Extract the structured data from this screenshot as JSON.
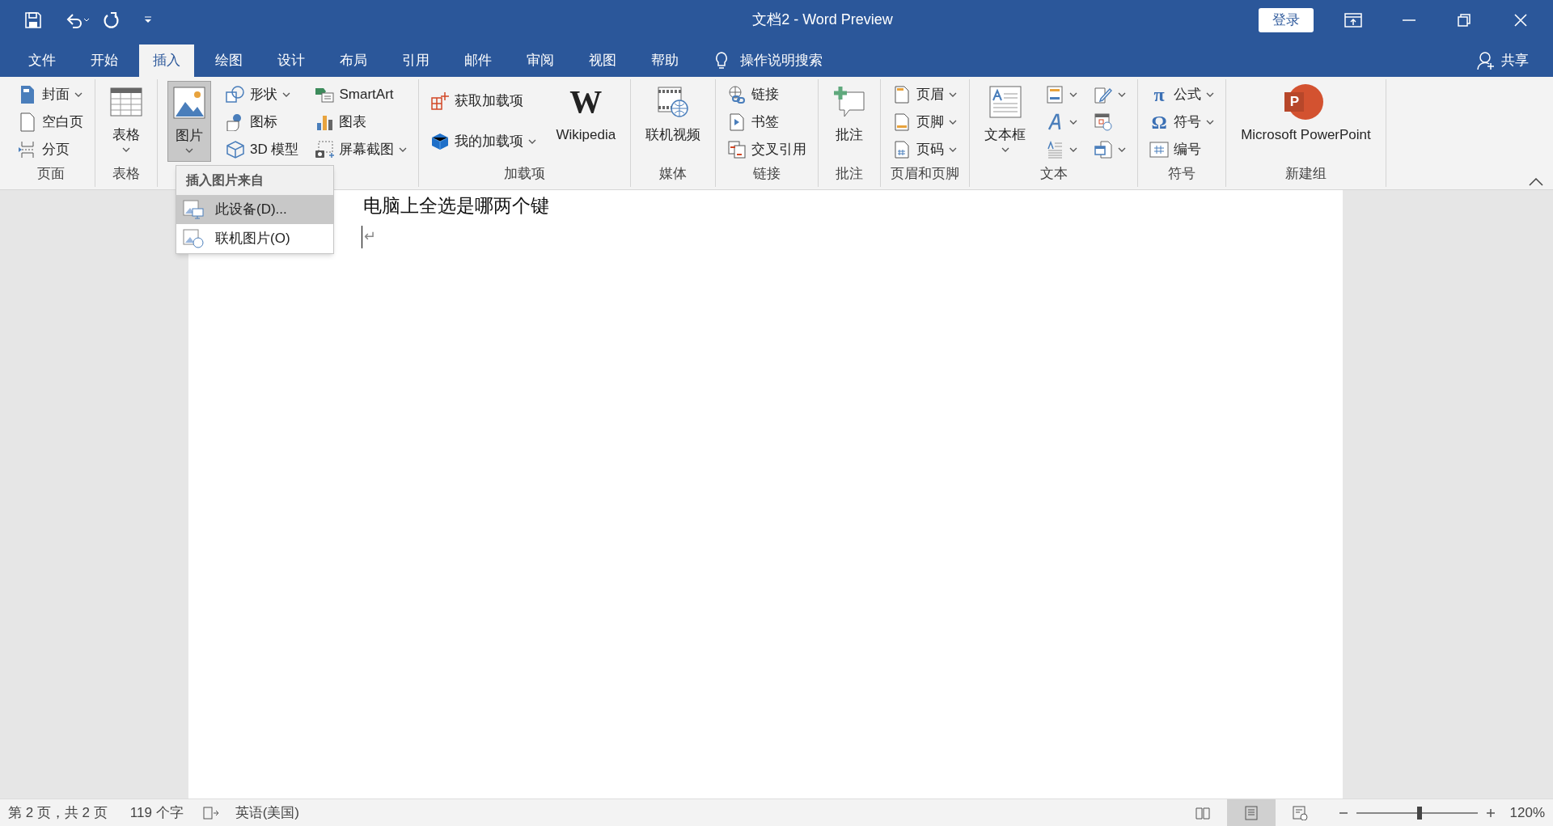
{
  "title_bar": {
    "title": "文档2  -  Word Preview",
    "sign_in": "登录"
  },
  "tabs": [
    {
      "label": "文件",
      "selected": false
    },
    {
      "label": "开始",
      "selected": false
    },
    {
      "label": "插入",
      "selected": true
    },
    {
      "label": "绘图",
      "selected": false
    },
    {
      "label": "设计",
      "selected": false
    },
    {
      "label": "布局",
      "selected": false
    },
    {
      "label": "引用",
      "selected": false
    },
    {
      "label": "邮件",
      "selected": false
    },
    {
      "label": "审阅",
      "selected": false
    },
    {
      "label": "视图",
      "selected": false
    },
    {
      "label": "帮助",
      "selected": false
    }
  ],
  "tell_me": "操作说明搜索",
  "share": "共享",
  "ribbon_groups": [
    {
      "label": "页面",
      "columns": [
        [
          {
            "kind": "small",
            "label": "封面",
            "caret": true
          },
          {
            "kind": "small",
            "label": "空白页",
            "caret": false
          },
          {
            "kind": "small",
            "label": "分页",
            "caret": false
          }
        ]
      ]
    },
    {
      "label": "表格",
      "columns": [
        [
          {
            "kind": "large",
            "label": "表格",
            "caret": true
          }
        ]
      ]
    },
    {
      "columns": [
        [
          {
            "kind": "large",
            "label": "图片",
            "caret": true,
            "pressed": true
          }
        ],
        [
          {
            "kind": "small",
            "label": "形状",
            "caret": true
          },
          {
            "kind": "small",
            "label": "图标",
            "caret": false
          },
          {
            "kind": "small",
            "label": "3D 模型",
            "caret": false
          }
        ],
        [
          {
            "kind": "small",
            "label": "SmartArt",
            "caret": false
          },
          {
            "kind": "small",
            "label": "图表",
            "caret": false
          },
          {
            "kind": "small",
            "label": "屏幕截图",
            "caret": true
          }
        ]
      ]
    },
    {
      "label": "加载项",
      "columns": [
        [
          {
            "kind": "small",
            "label": "获取加载项",
            "caret": false
          },
          {
            "kind": "small",
            "label": "我的加载项",
            "caret": true
          }
        ],
        [
          {
            "kind": "large",
            "label": "Wikipedia",
            "caret": false,
            "glyph": "W"
          }
        ]
      ]
    },
    {
      "label": "媒体",
      "columns": [
        [
          {
            "kind": "large",
            "label": "联机视频",
            "caret": false
          }
        ]
      ]
    },
    {
      "label": "链接",
      "columns": [
        [
          {
            "kind": "small",
            "label": "链接",
            "caret": false
          },
          {
            "kind": "small",
            "label": "书签",
            "caret": false
          },
          {
            "kind": "small",
            "label": "交叉引用",
            "caret": false
          }
        ]
      ]
    },
    {
      "label": "批注",
      "columns": [
        [
          {
            "kind": "large",
            "label": "批注",
            "caret": false
          }
        ]
      ]
    },
    {
      "label": "页眉和页脚",
      "columns": [
        [
          {
            "kind": "small",
            "label": "页眉",
            "caret": true
          },
          {
            "kind": "small",
            "label": "页脚",
            "caret": true
          },
          {
            "kind": "small",
            "label": "页码",
            "caret": true
          }
        ]
      ]
    },
    {
      "label": "文本",
      "columns": [
        [
          {
            "kind": "large",
            "label": "文本框",
            "caret": true
          }
        ],
        [
          {
            "kind": "small",
            "caret": true
          },
          {
            "kind": "small",
            "caret": true
          },
          {
            "kind": "small",
            "caret": true
          }
        ],
        [
          {
            "kind": "small",
            "caret": true
          },
          {
            "kind": "small",
            "caret": false
          },
          {
            "kind": "small",
            "caret": true
          }
        ]
      ]
    },
    {
      "label": "符号",
      "columns": [
        [
          {
            "kind": "small",
            "label": "公式",
            "caret": true,
            "glyph": "π"
          },
          {
            "kind": "small",
            "label": "符号",
            "caret": true,
            "glyph": "Ω"
          },
          {
            "kind": "small",
            "label": "编号",
            "caret": false
          }
        ]
      ]
    },
    {
      "label": "新建组",
      "columns": [
        [
          {
            "kind": "large",
            "label": "Microsoft PowerPoint",
            "caret": false,
            "glyph": "P"
          }
        ]
      ]
    }
  ],
  "dropdown": {
    "header": "插入图片来自",
    "items": [
      {
        "label": "此设备(D)...",
        "selected": true
      },
      {
        "label": "联机图片(O)",
        "selected": false
      }
    ]
  },
  "document": {
    "line": "电脑上全选是哪两个键",
    "paragraph_mark": "↵"
  },
  "status_bar": {
    "page": "第 2 页，共 2 页",
    "words": "119 个字",
    "language": "英语(美国)",
    "views": [
      {
        "selected": false
      },
      {
        "selected": true
      },
      {
        "selected": false
      }
    ],
    "zoom": {
      "level": 0.52
    },
    "zoom_text": "120%"
  }
}
